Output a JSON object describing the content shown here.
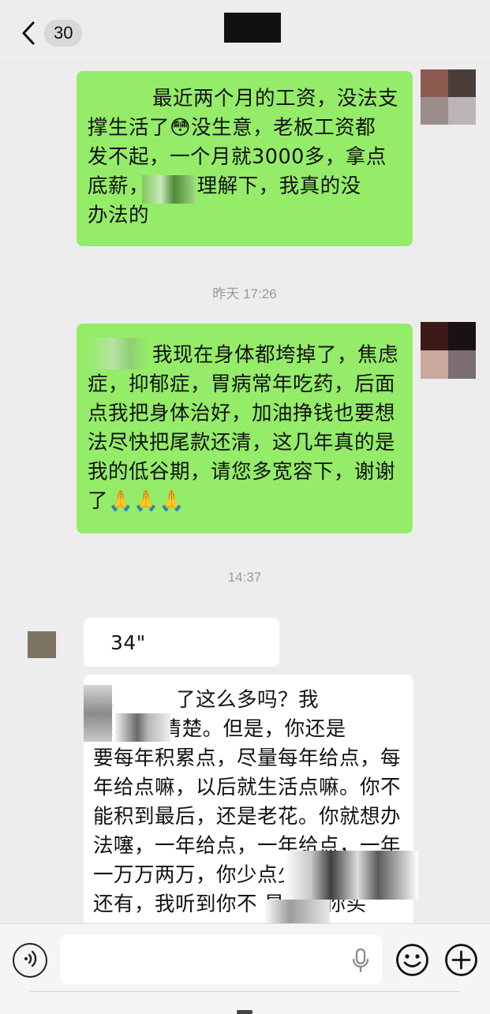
{
  "header": {
    "unread_count": "30",
    "title": ""
  },
  "messages": [
    {
      "sender": "self",
      "type": "text",
      "lines": [
        "最近两个月的工资，没法支",
        "撑生活了😳没生意，老板工资都",
        "发不起，一个月就3000多，拿点",
        "底薪，      请您理解下，我真的没",
        "办法的"
      ]
    },
    {
      "type": "timestamp",
      "text": "昨天 17:26"
    },
    {
      "sender": "self",
      "type": "text",
      "lines": [
        "我现在身体都垮掉了，焦虑",
        "症，抑郁症，胃病常年吃药，后面",
        "点我把身体治好，加油挣钱也要想",
        "法尽快把尾款还清，这几年真的是",
        "我的低谷期，请您多宽容下，谢谢",
        "了🙏🙏🙏"
      ]
    },
    {
      "type": "timestamp",
      "text": "14:37"
    },
    {
      "sender": "other",
      "type": "voice",
      "duration": "34\""
    },
    {
      "sender": "other",
      "type": "text",
      "lines": [
        "       工，你说了这么多吗？我",
        "是      我也清楚。但是，你还是",
        "要每年积累点，尽量每年给点，每",
        "年给点嘛，以后就生活点嘛。你不",
        "能积到最后，还是老花。你就想办",
        "法噻，一年给点，一年给点，一年",
        "一万万两万，你少点少              。",
        "还有，我听到你不      是啥子你买"
      ]
    }
  ],
  "input": {
    "value": "",
    "placeholder": ""
  },
  "icons": {
    "back": "chevron-left-icon",
    "voice": "voice-mode-icon",
    "mic": "microphone-icon",
    "emoji": "emoji-icon",
    "plus": "plus-icon"
  },
  "colors": {
    "self_bubble": "#95ec69",
    "other_bubble": "#ffffff",
    "background": "#ededed"
  }
}
